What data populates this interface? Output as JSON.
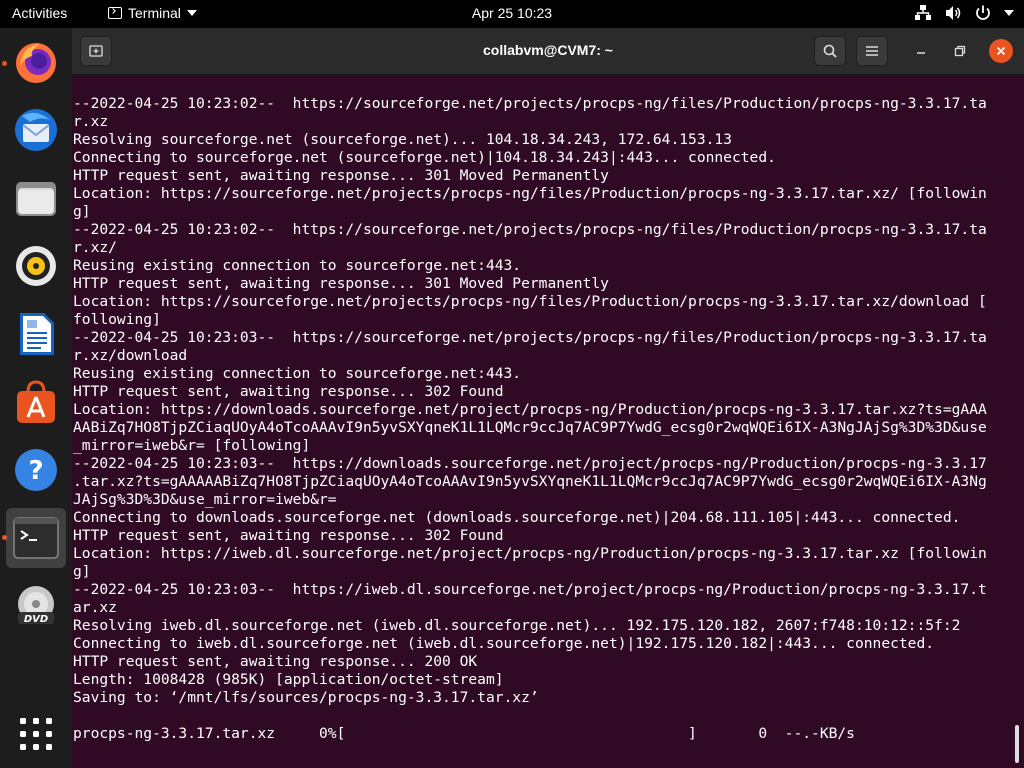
{
  "topbar": {
    "activities": "Activities",
    "app_name": "Terminal",
    "clock": "Apr 25  10:23"
  },
  "dock": {
    "items": [
      "firefox",
      "thunderbird",
      "files",
      "rhythmbox",
      "libreoffice-writer",
      "ubuntu-software",
      "help",
      "terminal",
      "dvd",
      "show-applications"
    ]
  },
  "window": {
    "title": "collabvm@CVM7: ~"
  },
  "terminal": {
    "lines": [
      "--2022-04-25 10:23:02--  https://sourceforge.net/projects/procps-ng/files/Production/procps-ng-3.3.17.ta",
      "r.xz",
      "Resolving sourceforge.net (sourceforge.net)... 104.18.34.243, 172.64.153.13",
      "Connecting to sourceforge.net (sourceforge.net)|104.18.34.243|:443... connected.",
      "HTTP request sent, awaiting response... 301 Moved Permanently",
      "Location: https://sourceforge.net/projects/procps-ng/files/Production/procps-ng-3.3.17.tar.xz/ [followin",
      "g]",
      "--2022-04-25 10:23:02--  https://sourceforge.net/projects/procps-ng/files/Production/procps-ng-3.3.17.ta",
      "r.xz/",
      "Reusing existing connection to sourceforge.net:443.",
      "HTTP request sent, awaiting response... 301 Moved Permanently",
      "Location: https://sourceforge.net/projects/procps-ng/files/Production/procps-ng-3.3.17.tar.xz/download [",
      "following]",
      "--2022-04-25 10:23:03--  https://sourceforge.net/projects/procps-ng/files/Production/procps-ng-3.3.17.ta",
      "r.xz/download",
      "Reusing existing connection to sourceforge.net:443.",
      "HTTP request sent, awaiting response... 302 Found",
      "Location: https://downloads.sourceforge.net/project/procps-ng/Production/procps-ng-3.3.17.tar.xz?ts=gAAA",
      "AABiZq7HO8TjpZCiaqUOyA4oTcoAAAvI9n5yvSXYqneK1L1LQMcr9ccJq7AC9P7YwdG_ecsg0r2wqWQEi6IX-A3NgJAjSg%3D%3D&use",
      "_mirror=iweb&r= [following]",
      "--2022-04-25 10:23:03--  https://downloads.sourceforge.net/project/procps-ng/Production/procps-ng-3.3.17",
      ".tar.xz?ts=gAAAAABiZq7HO8TjpZCiaqUOyA4oTcoAAAvI9n5yvSXYqneK1L1LQMcr9ccJq7AC9P7YwdG_ecsg0r2wqWQEi6IX-A3Ng",
      "JAjSg%3D%3D&use_mirror=iweb&r=",
      "Connecting to downloads.sourceforge.net (downloads.sourceforge.net)|204.68.111.105|:443... connected.",
      "HTTP request sent, awaiting response... 302 Found",
      "Location: https://iweb.dl.sourceforge.net/project/procps-ng/Production/procps-ng-3.3.17.tar.xz [followin",
      "g]",
      "--2022-04-25 10:23:03--  https://iweb.dl.sourceforge.net/project/procps-ng/Production/procps-ng-3.3.17.t",
      "ar.xz",
      "Resolving iweb.dl.sourceforge.net (iweb.dl.sourceforge.net)... 192.175.120.182, 2607:f748:10:12::5f:2",
      "Connecting to iweb.dl.sourceforge.net (iweb.dl.sourceforge.net)|192.175.120.182|:443... connected.",
      "HTTP request sent, awaiting response... 200 OK",
      "Length: 1008428 (985K) [application/octet-stream]",
      "Saving to: ‘/mnt/lfs/sources/procps-ng-3.3.17.tar.xz’",
      "",
      "procps-ng-3.3.17.tar.xz     0%[                                       ]       0  --.-KB/s"
    ]
  }
}
